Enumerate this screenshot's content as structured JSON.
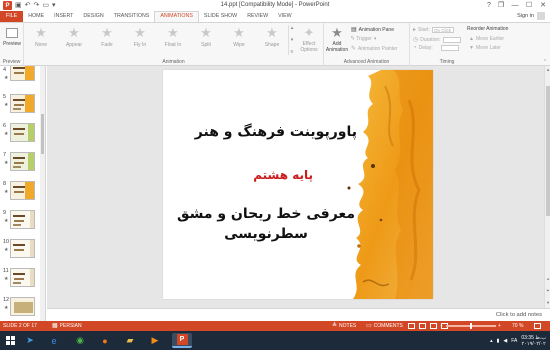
{
  "window": {
    "title": "14.ppt [Compatibility Mode] - PowerPoint",
    "help": "?",
    "restore": "❐",
    "minimize": "—",
    "maximize": "☐",
    "close": "✕"
  },
  "quick_access": {
    "app_letter": "P"
  },
  "tabs": [
    {
      "label": "FILE"
    },
    {
      "label": "HOME"
    },
    {
      "label": "INSERT"
    },
    {
      "label": "DESIGN"
    },
    {
      "label": "TRANSITIONS"
    },
    {
      "label": "ANIMATIONS"
    },
    {
      "label": "SLIDE SHOW"
    },
    {
      "label": "REVIEW"
    },
    {
      "label": "VIEW"
    }
  ],
  "signin": "Sign in",
  "ribbon": {
    "preview": {
      "label": "Preview",
      "group": "Preview"
    },
    "animation_group": "Animation",
    "animations": [
      {
        "label": "None",
        "icon": "★"
      },
      {
        "label": "Appear",
        "icon": "★"
      },
      {
        "label": "Fade",
        "icon": "★"
      },
      {
        "label": "Fly In",
        "icon": "★"
      },
      {
        "label": "Float In",
        "icon": "★"
      },
      {
        "label": "Split",
        "icon": "★"
      },
      {
        "label": "Wipe",
        "icon": "★"
      },
      {
        "label": "Shape",
        "icon": "★"
      }
    ],
    "effect_options": {
      "line1": "Effect",
      "line2": "Options"
    },
    "add_animation": {
      "line1": "Add",
      "line2": "Animation"
    },
    "advanced_group": "Advanced Animation",
    "animation_pane": "Animation Pane",
    "trigger": "Trigger",
    "animation_painter": "Animation Painter",
    "timing_group": "Timing",
    "start_label": "Start:",
    "start_value": "On Click",
    "duration_label": "Duration:",
    "delay_label": "Delay:",
    "reorder_title": "Reorder Animation",
    "move_earlier": "Move Earlier",
    "move_later": "Move Later"
  },
  "thumbnails": [
    {
      "num": "4",
      "star": "★"
    },
    {
      "num": "5",
      "star": "★"
    },
    {
      "num": "6",
      "star": "★"
    },
    {
      "num": "7",
      "star": "★"
    },
    {
      "num": "8",
      "star": "★"
    },
    {
      "num": "9",
      "star": "★"
    },
    {
      "num": "10",
      "star": "★"
    },
    {
      "num": "11",
      "star": "★"
    },
    {
      "num": "12",
      "star": "★"
    }
  ],
  "slide": {
    "title1": "پاورپوینت فرهنگ و هنر",
    "title2": "پایه هشتم",
    "title3_line1": "معرفی خط ریحان و مشق",
    "title3_line2": "سطرنویسی"
  },
  "notes_placeholder": "Click to add notes",
  "status": {
    "slide": "SLIDE 2 OF 17",
    "language": "PERSIAN",
    "notes": "NOTES",
    "comments": "COMMENTS",
    "zoom_minus": "−",
    "zoom_plus": "+",
    "zoom": "70 %",
    "zoom_fraction": 0.5
  },
  "clock": {
    "time": "03:35 ب.ظ",
    "date": "۲۰۱۹/۰۲/۰۲"
  },
  "tray": {
    "lang": "FA"
  },
  "colors": {
    "accent": "#d24726",
    "taskbar": "#1c2a3a"
  }
}
